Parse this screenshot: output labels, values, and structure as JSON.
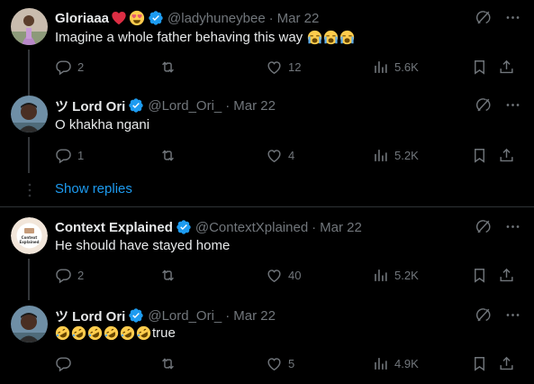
{
  "tweets": [
    {
      "name": "Gloriaaa",
      "name_emojis": [
        "red-heart",
        "heart-eyes"
      ],
      "handle": "@ladyhuneybee",
      "date": "Mar 22",
      "text": "Imagine a whole father behaving this way",
      "text_emojis": [
        "loudly-crying",
        "loudly-crying",
        "loudly-crying"
      ],
      "replies": "2",
      "retweets": "",
      "likes": "12",
      "views": "5.6K"
    },
    {
      "name": "ツ Lord Ori",
      "handle": "@Lord_Ori_",
      "date": "Mar 22",
      "text": "O khakha ngani",
      "replies": "1",
      "retweets": "",
      "likes": "4",
      "views": "5.2K"
    },
    {
      "name": "Context Explained",
      "handle": "@ContextXplained",
      "date": "Mar 22",
      "text": "He should have stayed home",
      "replies": "2",
      "retweets": "",
      "likes": "40",
      "views": "5.2K",
      "avatar_text": "Context Explained"
    },
    {
      "name": "ツ Lord Ori",
      "handle": "@Lord_Ori_",
      "date": "Mar 22",
      "text": "true",
      "text_emojis": [
        "rolling-laughing",
        "rolling-laughing",
        "rolling-laughing",
        "rolling-laughing",
        "rolling-laughing",
        "rolling-laughing"
      ],
      "replies": "",
      "retweets": "",
      "likes": "5",
      "views": "4.9K"
    }
  ],
  "show_replies": "Show replies",
  "dot_separator": "·",
  "colors": {
    "background": "#000000",
    "text": "#e7e9ea",
    "muted": "#71767b",
    "accent": "#1d9bf0",
    "verified": "#1d9bf0",
    "divider": "#2f3336"
  },
  "icons": [
    "grok-icon",
    "more-icon",
    "reply-icon",
    "retweet-icon",
    "like-icon",
    "views-icon",
    "bookmark-icon",
    "share-icon",
    "verified-badge-icon"
  ]
}
